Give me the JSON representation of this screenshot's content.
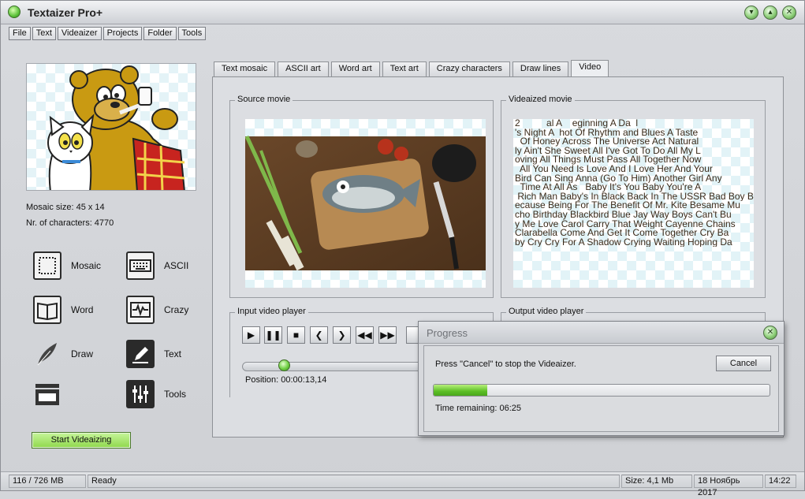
{
  "app": {
    "title": "Textaizer Pro+"
  },
  "menu": [
    "File",
    "Text",
    "Videaizer",
    "Projects",
    "Folder",
    "Tools"
  ],
  "left_panel": {
    "mosaic_size": "Mosaic size: 45 x 14",
    "nr_characters": "Nr. of characters: 4770",
    "tools": {
      "mosaic": "Mosaic",
      "ascii": "ASCII",
      "word": "Word",
      "crazy": "Crazy",
      "draw": "Draw",
      "text": "Text",
      "tools": "Tools"
    },
    "start_button": "Start Videaizing"
  },
  "tabs": [
    {
      "label": "Text mosaic"
    },
    {
      "label": "ASCII art"
    },
    {
      "label": "Word art"
    },
    {
      "label": "Text art"
    },
    {
      "label": "Crazy characters"
    },
    {
      "label": "Draw lines"
    },
    {
      "label": "Video",
      "active": true
    }
  ],
  "video": {
    "source_title": "Source movie",
    "videaized_title": "Videaized movie",
    "input_player_title": "Input video player",
    "output_player_title": "Output video player",
    "position": "Position: 00:00:13,14",
    "slider_fraction": 0.22,
    "ascii_lines": [
      "2          al A    eginning A Da  l",
      "'s Night A  hot Of Rhythm and Blues A Taste",
      "  Of Honey Across The Universe Act Natural",
      "ly Ain't She Sweet All I've Got To Do All My L",
      "oving All Things Must Pass All Together Now",
      "  All You Need Is Love And I Love Her And Your",
      "Bird Can Sing Anna (Go To Him) Another Girl Any",
      "  Time At All As   Baby It's You Baby You're A",
      " Rich Man Baby's In Black Back In The USSR Bad Boy B",
      "ecause Being For The Benefit Of Mr. Kite Besame Mu",
      "cho Birthday Blackbird Blue Jay Way Boys Can't Bu",
      "y Me Love Carol Carry That Weight Cayenne Chains",
      "Clarabella Come And Get It Come Together Cry Ba",
      "by Cry Cry For A Shadow Crying Waiting Hoping Da"
    ]
  },
  "progress_dialog": {
    "title": "Progress",
    "message": "Press \"Cancel\" to stop the Videaizer.",
    "cancel": "Cancel",
    "progress_fraction": 0.16,
    "time_remaining": "Time remaining: 06:25"
  },
  "statusbar": {
    "memory": "116 / 726 MB",
    "status": "Ready",
    "size": "Size: 4,1 Mb",
    "date": "18 Ноябрь 2017",
    "time": "14:22"
  },
  "colors": {
    "accent_green": "#6fcf43",
    "ascii_text": "#3a2a1a"
  }
}
